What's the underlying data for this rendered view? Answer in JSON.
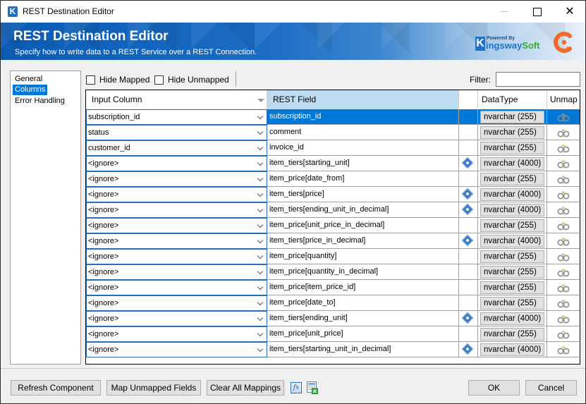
{
  "window": {
    "title": "REST Destination Editor",
    "app_icon_letter": "K",
    "controls": {
      "minimize": "minimize",
      "maximize": "maximize",
      "close": "✕"
    }
  },
  "banner": {
    "title": "REST Destination Editor",
    "subtitle": "Specify how to write data to a REST Service over a REST Connection.",
    "logo": {
      "k": "K",
      "powered_by": "Powered By",
      "brand_a": "ingsway",
      "brand_b": "Soft"
    }
  },
  "nav": {
    "items": [
      {
        "label": "General",
        "selected": false
      },
      {
        "label": "Columns",
        "selected": true
      },
      {
        "label": "Error Handling",
        "selected": false
      }
    ]
  },
  "toolbar": {
    "hide_mapped": {
      "label": "Hide Mapped",
      "checked": false
    },
    "hide_unmapped": {
      "label": "Hide Unmapped",
      "checked": false
    },
    "filter_label": "Filter:",
    "filter_value": ""
  },
  "grid": {
    "headers": {
      "input": "Input Column",
      "rest": "REST Field",
      "type": "DataType",
      "unmap": "Unmap"
    },
    "rows": [
      {
        "input": "subscription_id",
        "rest": "subscription_id",
        "info": false,
        "type": "nvarchar (255)",
        "selected": true
      },
      {
        "input": "status",
        "rest": "comment",
        "info": false,
        "type": "nvarchar (255)"
      },
      {
        "input": "customer_id",
        "rest": "invoice_id",
        "info": false,
        "type": "nvarchar (255)"
      },
      {
        "input": "<ignore>",
        "rest": "item_tiers[starting_unit]",
        "info": true,
        "type": "nvarchar (4000)"
      },
      {
        "input": "<ignore>",
        "rest": "item_price[date_from]",
        "info": false,
        "type": "nvarchar (255)"
      },
      {
        "input": "<ignore>",
        "rest": "item_tiers[price]",
        "info": true,
        "type": "nvarchar (4000)"
      },
      {
        "input": "<ignore>",
        "rest": "item_tiers[ending_unit_in_decimal]",
        "info": true,
        "type": "nvarchar (4000)"
      },
      {
        "input": "<ignore>",
        "rest": "item_price[unit_price_in_decimal]",
        "info": false,
        "type": "nvarchar (255)"
      },
      {
        "input": "<ignore>",
        "rest": "item_tiers[price_in_decimal]",
        "info": true,
        "type": "nvarchar (4000)"
      },
      {
        "input": "<ignore>",
        "rest": "item_price[quantity]",
        "info": false,
        "type": "nvarchar (255)"
      },
      {
        "input": "<ignore>",
        "rest": "item_price[quantity_in_decimal]",
        "info": false,
        "type": "nvarchar (255)"
      },
      {
        "input": "<ignore>",
        "rest": "item_price[item_price_id]",
        "info": false,
        "type": "nvarchar (255)"
      },
      {
        "input": "<ignore>",
        "rest": "item_price[date_to]",
        "info": false,
        "type": "nvarchar (255)"
      },
      {
        "input": "<ignore>",
        "rest": "item_tiers[ending_unit]",
        "info": true,
        "type": "nvarchar (4000)"
      },
      {
        "input": "<ignore>",
        "rest": "item_price[unit_price]",
        "info": false,
        "type": "nvarchar (255)"
      },
      {
        "input": "<ignore>",
        "rest": "item_tiers[starting_unit_in_decimal]",
        "info": true,
        "type": "nvarchar (4000)"
      }
    ]
  },
  "buttons": {
    "refresh": "Refresh Component",
    "map_unmapped": "Map Unmapped Fields",
    "clear_all": "Clear All Mappings",
    "fx": "fx",
    "ok": "OK",
    "cancel": "Cancel"
  },
  "colors": {
    "selection": "#0078d7",
    "header_highlight": "#bddcf1",
    "banner_blue": "#0b5bb4",
    "kingsway_green": "#3aa635",
    "chargebee_orange": "#f26b2a"
  }
}
